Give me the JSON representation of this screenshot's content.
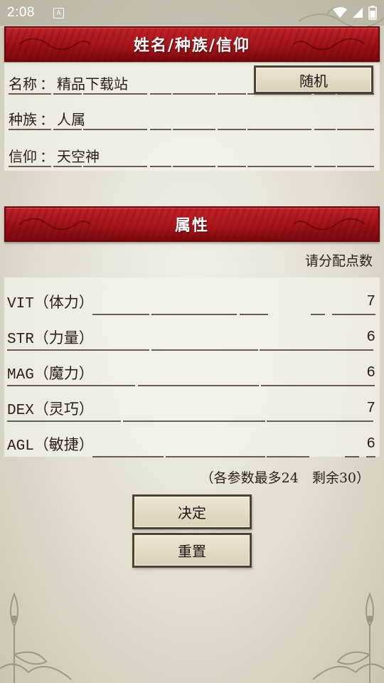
{
  "status_bar": {
    "time": "2:08",
    "app_icon_letter": "A",
    "icons": [
      "wifi-icon",
      "signal-icon",
      "battery-icon"
    ]
  },
  "identity_section": {
    "title": "姓名/种族/信仰",
    "separator": "：",
    "random_button_label": "随机",
    "fields": [
      {
        "label": "名称",
        "value": "精品下载站"
      },
      {
        "label": "种族",
        "value": "人属"
      },
      {
        "label": "信仰",
        "value": "天空神"
      }
    ]
  },
  "attributes_section": {
    "title": "属性",
    "prompt": "请分配点数",
    "attributes": [
      {
        "name": "VIT（体力）",
        "value": "7"
      },
      {
        "name": "STR（力量）",
        "value": "6"
      },
      {
        "name": "MAG（魔力）",
        "value": "6"
      },
      {
        "name": "DEX（灵巧）",
        "value": "7"
      },
      {
        "name": "AGL（敏捷）",
        "value": "6"
      }
    ],
    "limit_note": "（各参数最多24　剩余30）"
  },
  "actions": {
    "confirm_label": "决定",
    "reset_label": "重置"
  },
  "colors": {
    "banner_red": "#9a1016",
    "button_face": "#ddd6bf",
    "button_border": "#4d4330",
    "text": "#2a1f14"
  }
}
